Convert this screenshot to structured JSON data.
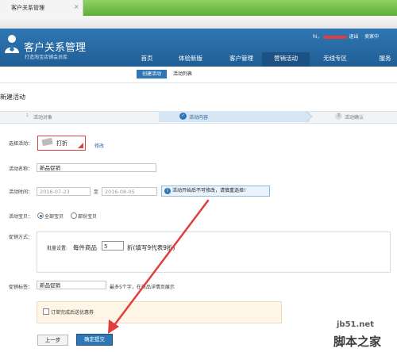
{
  "browser": {
    "tab_title": "客户关系管理",
    "tab_close": "×"
  },
  "header": {
    "title": "客户关系管理",
    "subtitle": "打造淘宝店铺会员库",
    "user_prefix": "hi，",
    "logout": "退出",
    "trailing": "卖家中"
  },
  "nav": {
    "items": [
      {
        "label": "首页"
      },
      {
        "label": "体验新版"
      },
      {
        "label": "客户管理"
      },
      {
        "label": "营销活动"
      },
      {
        "label": "无线专区"
      },
      {
        "label": "服务"
      }
    ],
    "active": "营销活动"
  },
  "subnav": {
    "items": [
      {
        "label": "创建活动"
      },
      {
        "label": "活动列表"
      }
    ],
    "active": "创建活动"
  },
  "page": {
    "title": "新建活动"
  },
  "steps": [
    {
      "num": "1",
      "label": "活动对象"
    },
    {
      "num": "✓",
      "label": "活动内容"
    },
    {
      "num": "3",
      "label": "活动确认"
    }
  ],
  "form": {
    "select_activity_label": "选择活动：",
    "selected_activity": "打折",
    "modify_link": "修改",
    "name_label": "活动名称：",
    "name_value": "新品促销",
    "time_label": "活动时间：",
    "start_date": "2016-07-23",
    "to": "至",
    "end_date": "2016-08-05",
    "time_notice": "活动开始后不可修改，请慎重选择!",
    "items_label": "活动宝贝：",
    "all_items": "全部宝贝",
    "some_items": "部份宝贝",
    "promo_label": "促销方式：",
    "batch_label": "批量设置:",
    "per_item": "每件商品",
    "discount_value": "5",
    "discount_suffix": "折(填写9代表9折)",
    "tag_label": "促销标签：",
    "tag_value": "新品促销",
    "tag_hint": "最多5个字，在商品详情页展示",
    "coupon_label": "订单完成后送优惠券"
  },
  "buttons": {
    "prev": "上一步",
    "submit": "确定提交"
  },
  "watermark": {
    "line1": "jb51.net",
    "line2": "脚本之家"
  },
  "colors": {
    "brand_blue": "#2f77b4",
    "nav_active": "#1d5183",
    "annotation_red": "#e23d3d",
    "tab_green": "#5fae35"
  }
}
